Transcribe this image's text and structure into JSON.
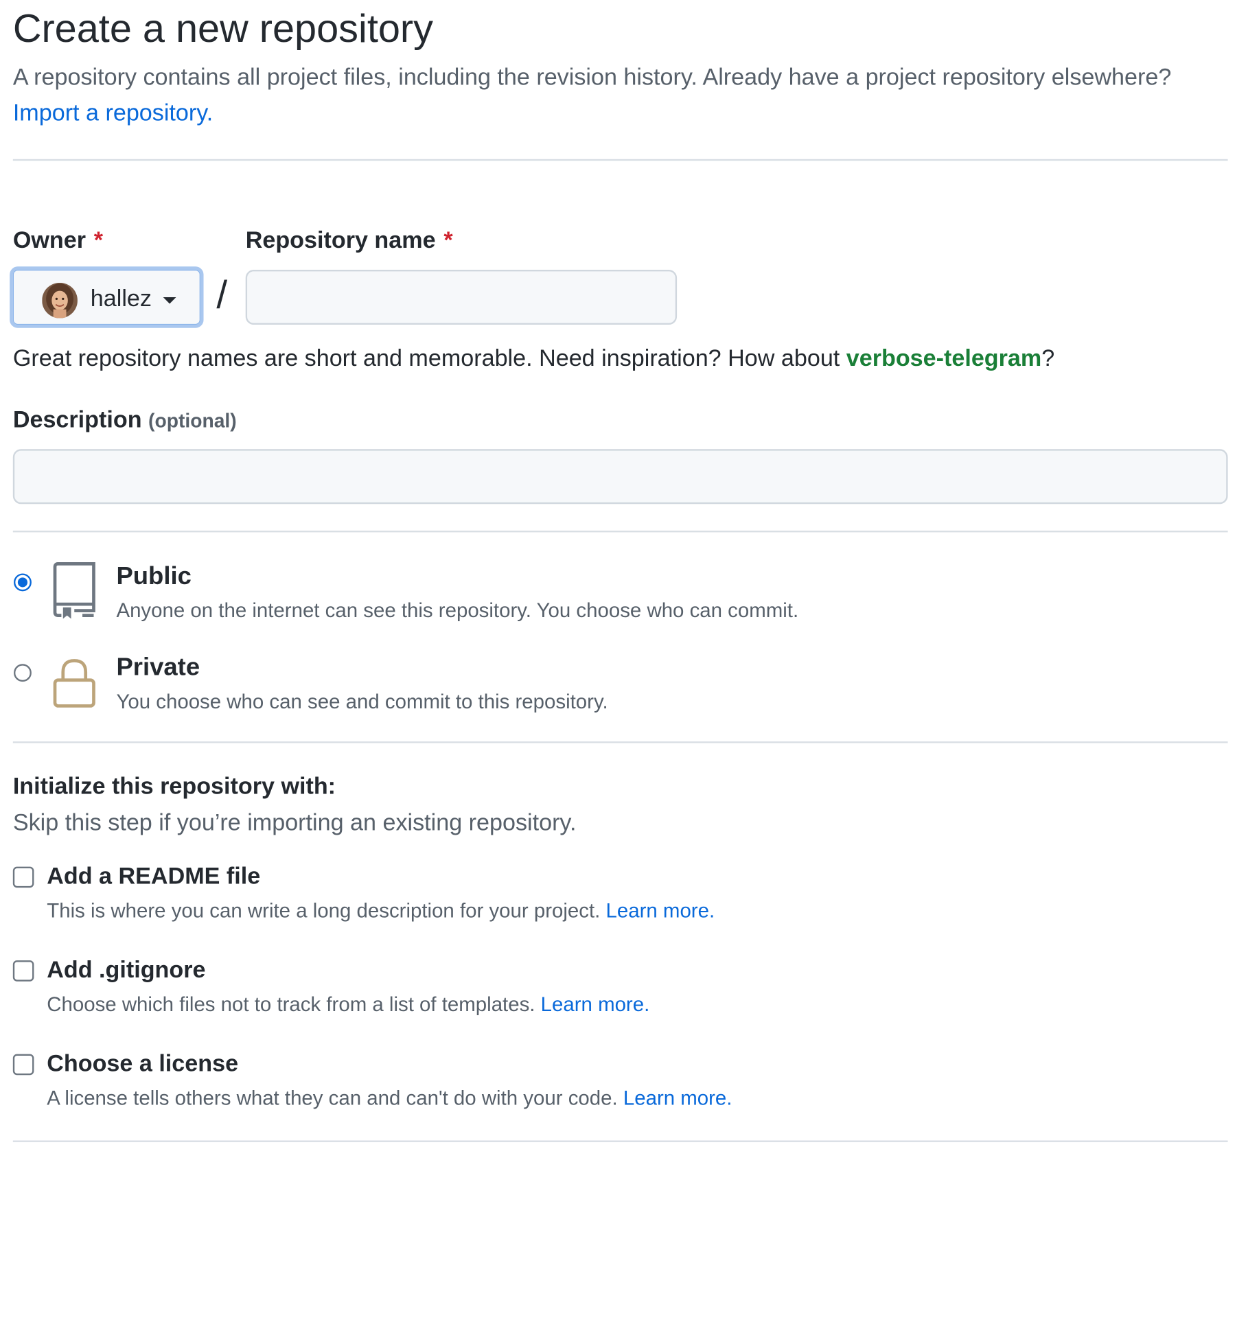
{
  "header": {
    "title": "Create a new repository",
    "subtitle": "A repository contains all project files, including the revision history. Already have a project repository elsewhere?",
    "import_link": "Import a repository."
  },
  "owner": {
    "label": "Owner",
    "required_mark": "*",
    "selected": "hallez",
    "avatar_icon": "user-avatar"
  },
  "repo_name": {
    "label": "Repository name",
    "required_mark": "*",
    "value": "",
    "separator": "/"
  },
  "name_hint": {
    "text": "Great repository names are short and memorable. Need inspiration? How about ",
    "suggestion": "verbose-telegram",
    "suffix": "?"
  },
  "description": {
    "label": "Description",
    "optional": "(optional)",
    "value": ""
  },
  "visibility": {
    "selected": "public",
    "options": [
      {
        "id": "public",
        "title": "Public",
        "description": "Anyone on the internet can see this repository. You choose who can commit.",
        "icon": "repo-book-icon",
        "checked": true
      },
      {
        "id": "private",
        "title": "Private",
        "description": "You choose who can see and commit to this repository.",
        "icon": "lock-icon",
        "checked": false
      }
    ]
  },
  "initialize": {
    "title": "Initialize this repository with:",
    "subtitle": "Skip this step if you’re importing an existing repository.",
    "options": [
      {
        "title": "Add a README file",
        "description": "This is where you can write a long description for your project.",
        "link": "Learn more.",
        "checked": false
      },
      {
        "title": "Add .gitignore",
        "description": "Choose which files not to track from a list of templates.",
        "link": "Learn more.",
        "checked": false
      },
      {
        "title": "Choose a license",
        "description": "A license tells others what they can and can't do with your code.",
        "link": "Learn more.",
        "checked": false
      }
    ]
  },
  "colors": {
    "link": "#0969da",
    "suggestion": "#1a7f37",
    "required": "#cf222e",
    "muted": "#57606a",
    "radio_selected": "#0969da",
    "lock_icon": "#bca47a"
  }
}
